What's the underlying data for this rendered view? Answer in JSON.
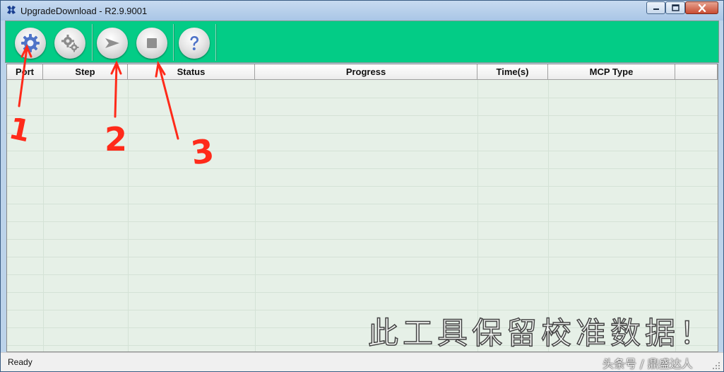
{
  "window": {
    "title": "UpgradeDownload - R2.9.9001"
  },
  "titlebar": {
    "minimize_icon": "minimize-icon",
    "maximize_icon": "maximize-icon",
    "close_icon": "close-icon"
  },
  "toolbar": {
    "background_color": "#03cc86",
    "buttons": [
      {
        "name": "settings",
        "icon": "gear-icon"
      },
      {
        "name": "advanced-settings",
        "icon": "gears-icon"
      },
      {
        "name": "start",
        "icon": "play-arrow-icon"
      },
      {
        "name": "stop",
        "icon": "stop-square-icon"
      },
      {
        "name": "help",
        "icon": "question-icon"
      }
    ]
  },
  "table": {
    "columns": [
      "Port",
      "Step",
      "Status",
      "Progress",
      "Time(s)",
      "MCP Type"
    ],
    "rows": []
  },
  "status_bar": {
    "text": "Ready"
  },
  "annotations": {
    "labels": [
      "1",
      "2",
      "3"
    ],
    "color": "#ff2a1a",
    "overlay_text": "此工具保留校准数据！",
    "watermark": "头条号 / 鼎盛达人"
  }
}
